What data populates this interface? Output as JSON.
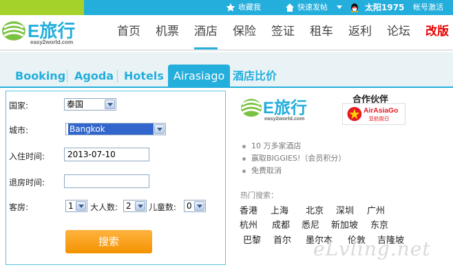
{
  "topbar": {
    "favorite": "收藏我",
    "quick_post": "快速发帖",
    "username": "太阳1975",
    "account_status": "帐号激活",
    "colors": {
      "lime": "#a4d22a",
      "blue": "#23aedc"
    }
  },
  "logo": {
    "brand": "E旅行",
    "sub": "easy2world.com"
  },
  "nav": [
    {
      "label": "首页"
    },
    {
      "label": "机票"
    },
    {
      "label": "酒店"
    },
    {
      "label": "保险"
    },
    {
      "label": "签证"
    },
    {
      "label": "租车"
    },
    {
      "label": "返利"
    },
    {
      "label": "论坛"
    },
    {
      "label": "改版"
    }
  ],
  "tabs": [
    {
      "label": "Booking"
    },
    {
      "label": "Agoda"
    },
    {
      "label": "Hotels"
    },
    {
      "label": "Airasiago"
    },
    {
      "label": "酒店比价"
    }
  ],
  "form": {
    "country_label": "国家:",
    "country_value": "泰国",
    "city_label": "城市:",
    "city_value": "Bangkok",
    "checkin_label": "入住时间:",
    "checkin_value": "2013-07-10",
    "checkout_label": "退房时间:",
    "checkout_value": "",
    "rooms_label": "客房:",
    "rooms_value": "1",
    "adults_label": "大人数:",
    "adults_value": "2",
    "children_label": "儿童数:",
    "children_value": "0",
    "search_button": "搜索"
  },
  "info": {
    "partner_title": "合作伙伴",
    "partner_name": "AirAsiaGo",
    "partner_sub": "亚航假日",
    "bullets": [
      "10 万多家酒店",
      "赢取BIGGIES!（会员积分）",
      "免费取消"
    ],
    "hot_title": "热门搜索：",
    "cities": [
      [
        "香港",
        "上海",
        "北京",
        "深圳",
        "广州"
      ],
      [
        "杭州",
        "成都",
        "悉尼",
        "新加坡",
        "东京"
      ],
      [
        "巴黎",
        "首尔",
        "墨尔本",
        "伦敦",
        "吉隆坡"
      ]
    ]
  },
  "watermark": "eLvling.net"
}
